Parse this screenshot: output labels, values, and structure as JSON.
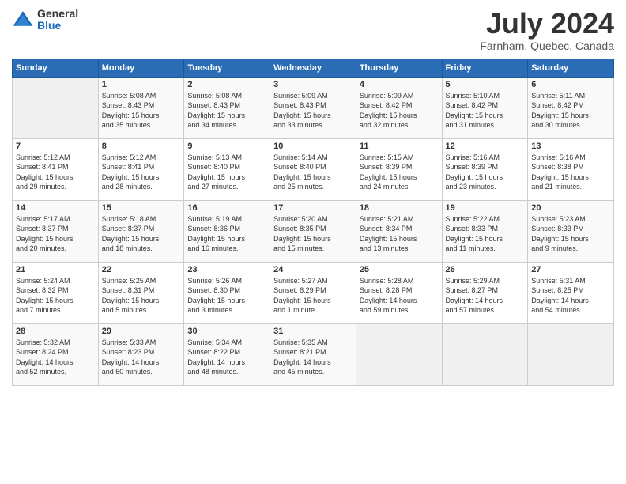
{
  "logo": {
    "general": "General",
    "blue": "Blue"
  },
  "title": "July 2024",
  "location": "Farnham, Quebec, Canada",
  "days_header": [
    "Sunday",
    "Monday",
    "Tuesday",
    "Wednesday",
    "Thursday",
    "Friday",
    "Saturday"
  ],
  "weeks": [
    [
      {
        "day": "",
        "info": ""
      },
      {
        "day": "1",
        "info": "Sunrise: 5:08 AM\nSunset: 8:43 PM\nDaylight: 15 hours\nand 35 minutes."
      },
      {
        "day": "2",
        "info": "Sunrise: 5:08 AM\nSunset: 8:43 PM\nDaylight: 15 hours\nand 34 minutes."
      },
      {
        "day": "3",
        "info": "Sunrise: 5:09 AM\nSunset: 8:43 PM\nDaylight: 15 hours\nand 33 minutes."
      },
      {
        "day": "4",
        "info": "Sunrise: 5:09 AM\nSunset: 8:42 PM\nDaylight: 15 hours\nand 32 minutes."
      },
      {
        "day": "5",
        "info": "Sunrise: 5:10 AM\nSunset: 8:42 PM\nDaylight: 15 hours\nand 31 minutes."
      },
      {
        "day": "6",
        "info": "Sunrise: 5:11 AM\nSunset: 8:42 PM\nDaylight: 15 hours\nand 30 minutes."
      }
    ],
    [
      {
        "day": "7",
        "info": "Sunrise: 5:12 AM\nSunset: 8:41 PM\nDaylight: 15 hours\nand 29 minutes."
      },
      {
        "day": "8",
        "info": "Sunrise: 5:12 AM\nSunset: 8:41 PM\nDaylight: 15 hours\nand 28 minutes."
      },
      {
        "day": "9",
        "info": "Sunrise: 5:13 AM\nSunset: 8:40 PM\nDaylight: 15 hours\nand 27 minutes."
      },
      {
        "day": "10",
        "info": "Sunrise: 5:14 AM\nSunset: 8:40 PM\nDaylight: 15 hours\nand 25 minutes."
      },
      {
        "day": "11",
        "info": "Sunrise: 5:15 AM\nSunset: 8:39 PM\nDaylight: 15 hours\nand 24 minutes."
      },
      {
        "day": "12",
        "info": "Sunrise: 5:16 AM\nSunset: 8:39 PM\nDaylight: 15 hours\nand 23 minutes."
      },
      {
        "day": "13",
        "info": "Sunrise: 5:16 AM\nSunset: 8:38 PM\nDaylight: 15 hours\nand 21 minutes."
      }
    ],
    [
      {
        "day": "14",
        "info": "Sunrise: 5:17 AM\nSunset: 8:37 PM\nDaylight: 15 hours\nand 20 minutes."
      },
      {
        "day": "15",
        "info": "Sunrise: 5:18 AM\nSunset: 8:37 PM\nDaylight: 15 hours\nand 18 minutes."
      },
      {
        "day": "16",
        "info": "Sunrise: 5:19 AM\nSunset: 8:36 PM\nDaylight: 15 hours\nand 16 minutes."
      },
      {
        "day": "17",
        "info": "Sunrise: 5:20 AM\nSunset: 8:35 PM\nDaylight: 15 hours\nand 15 minutes."
      },
      {
        "day": "18",
        "info": "Sunrise: 5:21 AM\nSunset: 8:34 PM\nDaylight: 15 hours\nand 13 minutes."
      },
      {
        "day": "19",
        "info": "Sunrise: 5:22 AM\nSunset: 8:33 PM\nDaylight: 15 hours\nand 11 minutes."
      },
      {
        "day": "20",
        "info": "Sunrise: 5:23 AM\nSunset: 8:33 PM\nDaylight: 15 hours\nand 9 minutes."
      }
    ],
    [
      {
        "day": "21",
        "info": "Sunrise: 5:24 AM\nSunset: 8:32 PM\nDaylight: 15 hours\nand 7 minutes."
      },
      {
        "day": "22",
        "info": "Sunrise: 5:25 AM\nSunset: 8:31 PM\nDaylight: 15 hours\nand 5 minutes."
      },
      {
        "day": "23",
        "info": "Sunrise: 5:26 AM\nSunset: 8:30 PM\nDaylight: 15 hours\nand 3 minutes."
      },
      {
        "day": "24",
        "info": "Sunrise: 5:27 AM\nSunset: 8:29 PM\nDaylight: 15 hours\nand 1 minute."
      },
      {
        "day": "25",
        "info": "Sunrise: 5:28 AM\nSunset: 8:28 PM\nDaylight: 14 hours\nand 59 minutes."
      },
      {
        "day": "26",
        "info": "Sunrise: 5:29 AM\nSunset: 8:27 PM\nDaylight: 14 hours\nand 57 minutes."
      },
      {
        "day": "27",
        "info": "Sunrise: 5:31 AM\nSunset: 8:25 PM\nDaylight: 14 hours\nand 54 minutes."
      }
    ],
    [
      {
        "day": "28",
        "info": "Sunrise: 5:32 AM\nSunset: 8:24 PM\nDaylight: 14 hours\nand 52 minutes."
      },
      {
        "day": "29",
        "info": "Sunrise: 5:33 AM\nSunset: 8:23 PM\nDaylight: 14 hours\nand 50 minutes."
      },
      {
        "day": "30",
        "info": "Sunrise: 5:34 AM\nSunset: 8:22 PM\nDaylight: 14 hours\nand 48 minutes."
      },
      {
        "day": "31",
        "info": "Sunrise: 5:35 AM\nSunset: 8:21 PM\nDaylight: 14 hours\nand 45 minutes."
      },
      {
        "day": "",
        "info": ""
      },
      {
        "day": "",
        "info": ""
      },
      {
        "day": "",
        "info": ""
      }
    ]
  ]
}
